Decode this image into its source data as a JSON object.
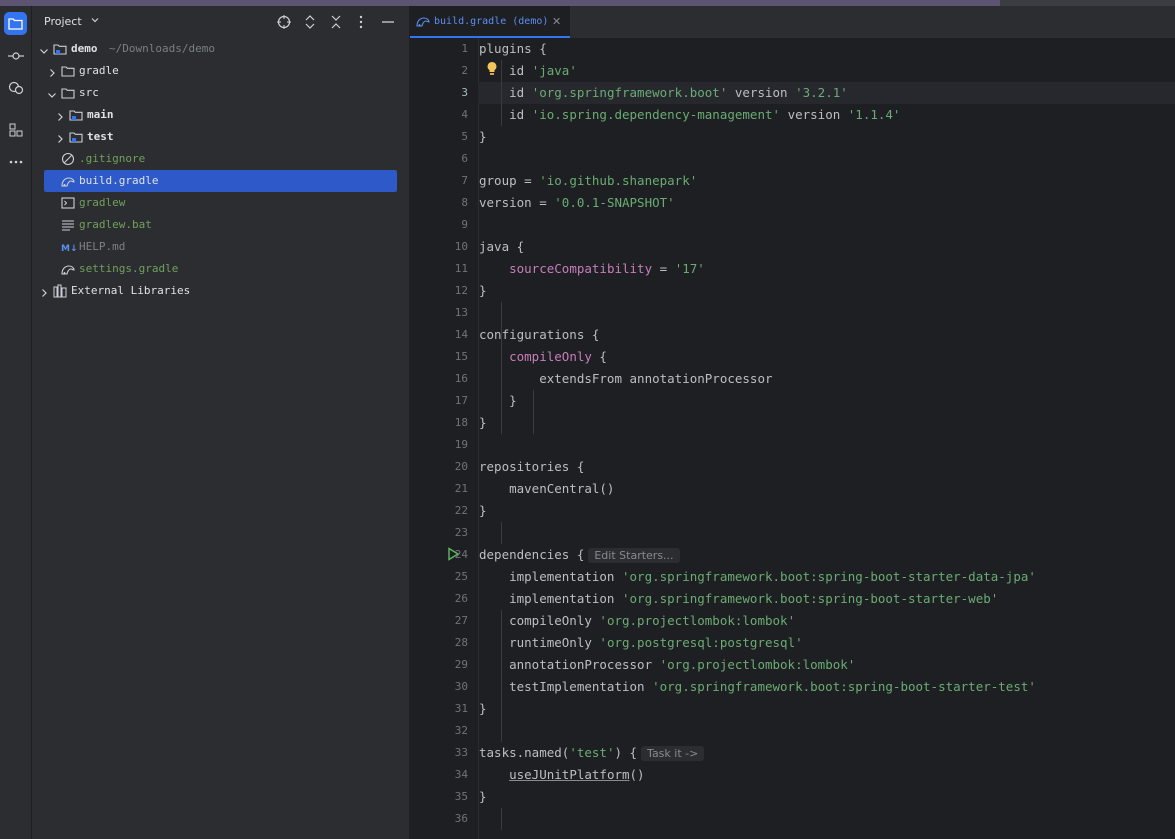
{
  "panel": {
    "title": "Project",
    "tree": [
      {
        "label": "demo",
        "path": "~/Downloads/demo",
        "indent": 0,
        "expanded": true,
        "icon": "module-folder",
        "style": "bold"
      },
      {
        "label": "gradle",
        "indent": 1,
        "expanded": false,
        "icon": "folder",
        "style": "norm"
      },
      {
        "label": "src",
        "indent": 1,
        "expanded": true,
        "icon": "folder",
        "style": "norm"
      },
      {
        "label": "main",
        "indent": 2,
        "expanded": false,
        "icon": "module-folder",
        "style": "bold"
      },
      {
        "label": "test",
        "indent": 2,
        "expanded": false,
        "icon": "module-folder",
        "style": "bold"
      },
      {
        "label": ".gitignore",
        "indent": 1,
        "icon": "ignore-file",
        "style": "green"
      },
      {
        "label": "build.gradle",
        "indent": 1,
        "icon": "gradle-file",
        "style": "norm",
        "selected": true
      },
      {
        "label": "gradlew",
        "indent": 1,
        "icon": "shell-file",
        "style": "green"
      },
      {
        "label": "gradlew.bat",
        "indent": 1,
        "icon": "text-file",
        "style": "green"
      },
      {
        "label": "HELP.md",
        "indent": 1,
        "icon": "markdown-file",
        "style": "gray"
      },
      {
        "label": "settings.gradle",
        "indent": 1,
        "icon": "gradle-file",
        "style": "green"
      },
      {
        "label": "External Libraries",
        "indent": 0,
        "expanded": false,
        "icon": "library",
        "style": "norm"
      }
    ]
  },
  "editor": {
    "tab_label": "build.gradle (demo)",
    "current_line": 3,
    "hints": {
      "edit_starters": "Edit Starters...",
      "task_it": "Task it ->"
    },
    "lines": [
      {
        "n": "1",
        "t": "plugins {"
      },
      {
        "n": "2",
        "t": "    id 'java'"
      },
      {
        "n": "3",
        "t": "    id 'org.springframework.boot' version '3.2.1'"
      },
      {
        "n": "4",
        "t": "    id 'io.spring.dependency-management' version '1.1.4'"
      },
      {
        "n": "5",
        "t": "}"
      },
      {
        "n": "6",
        "t": ""
      },
      {
        "n": "7",
        "t": "group = 'io.github.shanepark'"
      },
      {
        "n": "8",
        "t": "version = '0.0.1-SNAPSHOT'"
      },
      {
        "n": "9",
        "t": ""
      },
      {
        "n": "10",
        "t": "java {"
      },
      {
        "n": "11",
        "t": "    sourceCompatibility = '17'"
      },
      {
        "n": "12",
        "t": "}"
      },
      {
        "n": "13",
        "t": ""
      },
      {
        "n": "14",
        "t": "configurations {"
      },
      {
        "n": "15",
        "t": "    compileOnly {"
      },
      {
        "n": "16",
        "t": "        extendsFrom annotationProcessor"
      },
      {
        "n": "17",
        "t": "    }"
      },
      {
        "n": "18",
        "t": "}"
      },
      {
        "n": "19",
        "t": ""
      },
      {
        "n": "20",
        "t": "repositories {"
      },
      {
        "n": "21",
        "t": "    mavenCentral()"
      },
      {
        "n": "22",
        "t": "}"
      },
      {
        "n": "23",
        "t": ""
      },
      {
        "n": "24",
        "t": "dependencies {"
      },
      {
        "n": "25",
        "t": "    implementation 'org.springframework.boot:spring-boot-starter-data-jpa'"
      },
      {
        "n": "26",
        "t": "    implementation 'org.springframework.boot:spring-boot-starter-web'"
      },
      {
        "n": "27",
        "t": "    compileOnly 'org.projectlombok:lombok'"
      },
      {
        "n": "28",
        "t": "    runtimeOnly 'org.postgresql:postgresql'"
      },
      {
        "n": "29",
        "t": "    annotationProcessor 'org.projectlombok:lombok'"
      },
      {
        "n": "30",
        "t": "    testImplementation 'org.springframework.boot:spring-boot-starter-test'"
      },
      {
        "n": "31",
        "t": "}"
      },
      {
        "n": "32",
        "t": ""
      },
      {
        "n": "33",
        "t": "tasks.named('test') {"
      },
      {
        "n": "34",
        "t": "    useJUnitPlatform()"
      },
      {
        "n": "35",
        "t": "}"
      },
      {
        "n": "36",
        "t": ""
      }
    ]
  },
  "colors": {
    "accent": "#3574f0",
    "string": "#6aab73",
    "selection": "#2e5ac9"
  }
}
